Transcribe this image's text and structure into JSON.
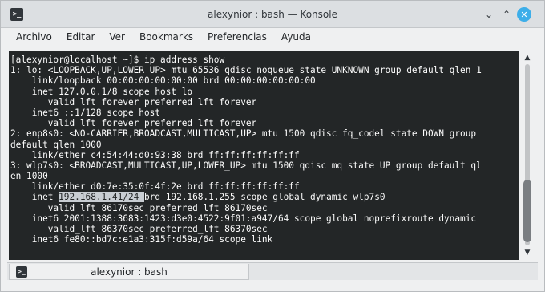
{
  "window": {
    "title": "alexynior : bash — Konsole"
  },
  "menubar": {
    "items": [
      "Archivo",
      "Editar",
      "Ver",
      "Bookmarks",
      "Preferencias",
      "Ayuda"
    ]
  },
  "terminal": {
    "lines": [
      "[alexynior@localhost ~]$ ip address show",
      "1: lo: <LOOPBACK,UP,LOWER_UP> mtu 65536 qdisc noqueue state UNKNOWN group default qlen 1",
      "    link/loopback 00:00:00:00:00:00 brd 00:00:00:00:00:00",
      "    inet 127.0.0.1/8 scope host lo",
      "       valid_lft forever preferred_lft forever",
      "    inet6 ::1/128 scope host",
      "       valid_lft forever preferred_lft forever",
      "2: enp8s0: <NO-CARRIER,BROADCAST,MULTICAST,UP> mtu 1500 qdisc fq_codel state DOWN group",
      "default qlen 1000",
      "    link/ether c4:54:44:d0:93:38 brd ff:ff:ff:ff:ff:ff",
      "3: wlp7s0: <BROADCAST,MULTICAST,UP,LOWER_UP> mtu 1500 qdisc mq state UP group default ql",
      "en 1000",
      "    link/ether d0:7e:35:0f:4f:2e brd ff:ff:ff:ff:ff:ff",
      "inet_line",
      "       valid_lft 86170sec preferred_lft 86170sec",
      "    inet6 2001:1388:3683:1423:d3e0:4522:9f01:a947/64 scope global noprefixroute dynamic",
      "       valid_lft 86370sec preferred_lft 86370sec",
      "    inet6 fe80::bd7c:e1a3:315f:d59a/64 scope link"
    ],
    "inet_line": {
      "prefix": "    inet ",
      "selected": "192.168.1.41/24 ",
      "suffix": "brd 192.168.1.255 scope global dynamic wlp7s0"
    }
  },
  "tabs": [
    {
      "label": "alexynior : bash"
    }
  ],
  "icons": {
    "app": "terminal-icon",
    "minimize": "chevron-down-icon",
    "maximize": "chevron-up-icon",
    "close": "close-icon",
    "scroll_up": "arrow-up-icon",
    "scroll_down": "arrow-down-icon"
  },
  "colors": {
    "terminal_bg": "#232627",
    "terminal_fg": "#fcfcfc",
    "selection_bg": "#c8cdd2",
    "close_button": "#3daee9"
  },
  "scroll": {
    "position_fraction": 0.7,
    "visible_fraction": 0.35
  }
}
